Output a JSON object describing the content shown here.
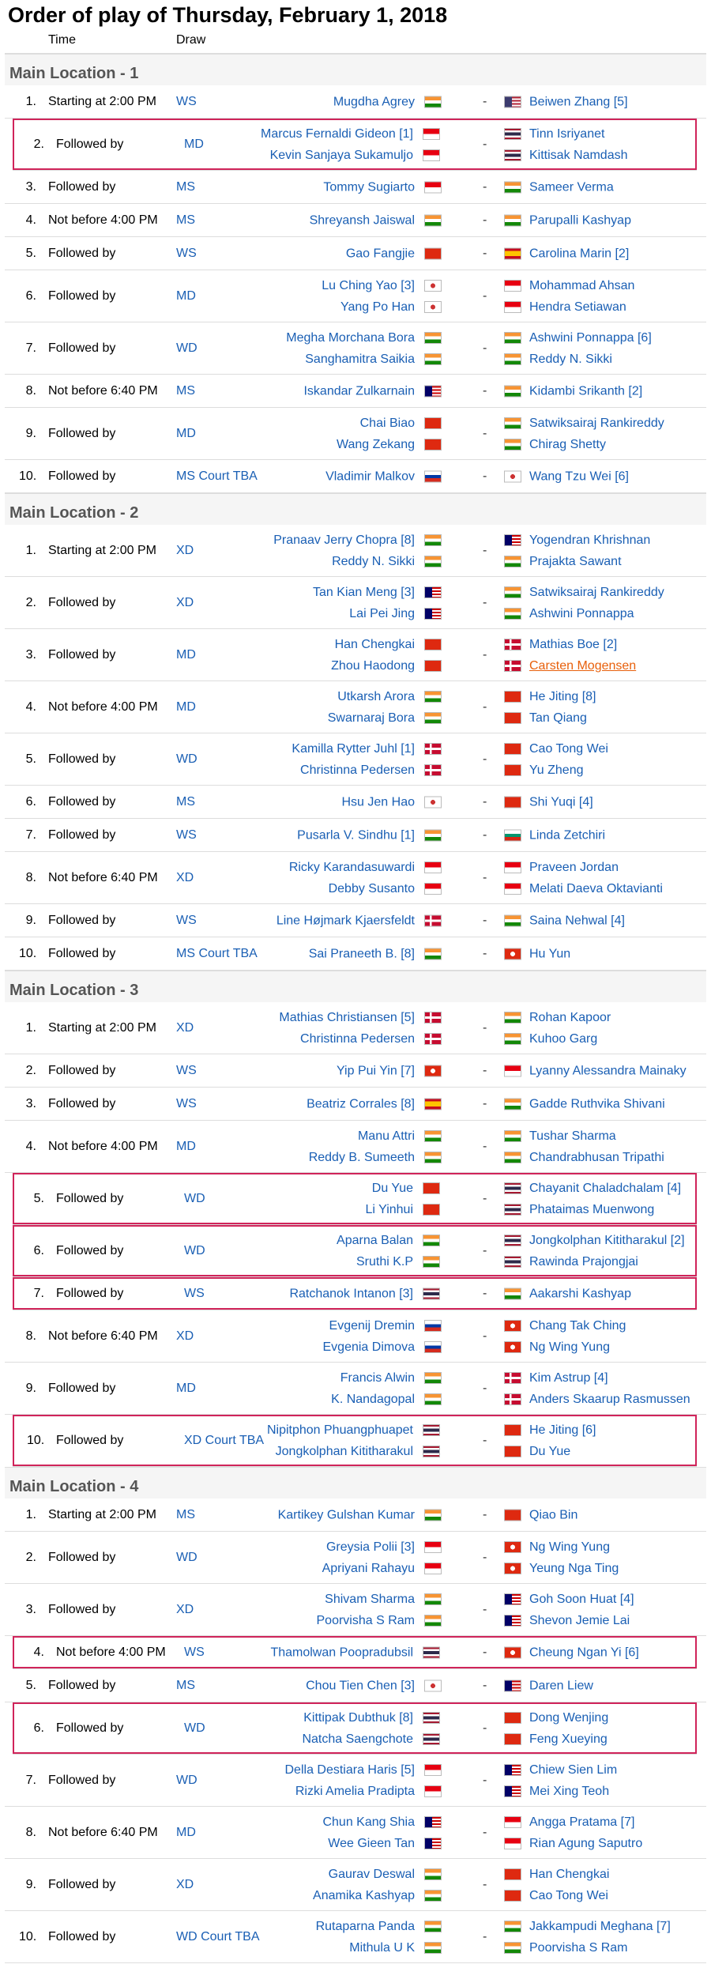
{
  "title": "Order of play of Thursday, February 1, 2018",
  "col_time": "Time",
  "col_draw": "Draw",
  "dash": "-",
  "flags": {
    "IND": "linear-gradient(#f79433 0 33%,#fff 33% 66%,#138808 66%)",
    "USA": "linear-gradient(90deg,#3c3b6e 0 45%,transparent 45%),repeating-linear-gradient(#b22234 0 2px,#fff 2px 4px)",
    "INA": "linear-gradient(#e70011 0 50%,#fff 50%)",
    "THA": "linear-gradient(#a51931 0 17%,#fff 17% 33%,#2d2a4a 33% 67%,#fff 67% 83%,#a51931 83%)",
    "CHN": "#de2910",
    "ESP": "linear-gradient(#c60b1e 0 25%,#ffc400 25% 75%,#c60b1e 75%)",
    "TPE": "radial-gradient(circle,#c33 0 3px,#fff 3px)",
    "MAS": "linear-gradient(90deg,#010066 0 45%,transparent 45%),repeating-linear-gradient(#cc0001 0 2px,#fff 2px 4px)",
    "RUS": "linear-gradient(#fff 0 33%,#0039a6 33% 66%,#d52b1e 66%)",
    "DEN": "linear-gradient(90deg,transparent 0 30%,#fff 30% 42%,transparent 42%),linear-gradient(transparent 0 40%,#fff 40% 60%,transparent 60%),#c60c30",
    "HKG": "radial-gradient(circle,#fff 0 3px,#de2910 3px)",
    "BUL": "linear-gradient(#fff 0 33%,#00966e 33% 66%,#d62612 66%)"
  },
  "sections": [
    {
      "title": "Main Location - 1",
      "rows": [
        {
          "n": "1.",
          "t": "Starting at 2:00 PM",
          "d": "WS",
          "l": [
            [
              "Mugdha Agrey",
              "IND"
            ]
          ],
          "r": [
            [
              "Beiwen Zhang [5]",
              "USA"
            ]
          ]
        },
        {
          "n": "2.",
          "t": "Followed by",
          "d": "MD",
          "hl": true,
          "l": [
            [
              "Marcus Fernaldi Gideon [1]",
              "INA"
            ],
            [
              "Kevin Sanjaya Sukamuljo",
              "INA"
            ]
          ],
          "r": [
            [
              "Tinn Isriyanet",
              "THA"
            ],
            [
              "Kittisak Namdash",
              "THA"
            ]
          ]
        },
        {
          "n": "3.",
          "t": "Followed by",
          "d": "MS",
          "l": [
            [
              "Tommy Sugiarto",
              "INA"
            ]
          ],
          "r": [
            [
              "Sameer Verma",
              "IND"
            ]
          ]
        },
        {
          "n": "4.",
          "t": "Not before 4:00 PM",
          "d": "MS",
          "l": [
            [
              "Shreyansh Jaiswal",
              "IND"
            ]
          ],
          "r": [
            [
              "Parupalli Kashyap",
              "IND"
            ]
          ]
        },
        {
          "n": "5.",
          "t": "Followed by",
          "d": "WS",
          "l": [
            [
              "Gao Fangjie",
              "CHN"
            ]
          ],
          "r": [
            [
              "Carolina Marin [2]",
              "ESP"
            ]
          ]
        },
        {
          "n": "6.",
          "t": "Followed by",
          "d": "MD",
          "l": [
            [
              "Lu Ching Yao [3]",
              "TPE"
            ],
            [
              "Yang Po Han",
              "TPE"
            ]
          ],
          "r": [
            [
              "Mohammad Ahsan",
              "INA"
            ],
            [
              "Hendra Setiawan",
              "INA"
            ]
          ]
        },
        {
          "n": "7.",
          "t": "Followed by",
          "d": "WD",
          "l": [
            [
              "Megha Morchana Bora",
              "IND"
            ],
            [
              "Sanghamitra Saikia",
              "IND"
            ]
          ],
          "r": [
            [
              "Ashwini Ponnappa [6]",
              "IND"
            ],
            [
              "Reddy N. Sikki",
              "IND"
            ]
          ]
        },
        {
          "n": "8.",
          "t": "Not before 6:40 PM",
          "d": "MS",
          "l": [
            [
              "Iskandar Zulkarnain",
              "MAS"
            ]
          ],
          "r": [
            [
              "Kidambi Srikanth [2]",
              "IND"
            ]
          ]
        },
        {
          "n": "9.",
          "t": "Followed by",
          "d": "MD",
          "l": [
            [
              "Chai Biao",
              "CHN"
            ],
            [
              "Wang Zekang",
              "CHN"
            ]
          ],
          "r": [
            [
              "Satwiksairaj Rankireddy",
              "IND"
            ],
            [
              "Chirag Shetty",
              "IND"
            ]
          ]
        },
        {
          "n": "10.",
          "t": "Followed by",
          "d": "MS Court TBA",
          "l": [
            [
              "Vladimir Malkov",
              "RUS"
            ]
          ],
          "r": [
            [
              "Wang Tzu Wei [6]",
              "TPE"
            ]
          ]
        }
      ]
    },
    {
      "title": "Main Location - 2",
      "rows": [
        {
          "n": "1.",
          "t": "Starting at 2:00 PM",
          "d": "XD",
          "l": [
            [
              "Pranaav Jerry Chopra [8]",
              "IND"
            ],
            [
              "Reddy N. Sikki",
              "IND"
            ]
          ],
          "r": [
            [
              "Yogendran Khrishnan",
              "MAS"
            ],
            [
              "Prajakta Sawant",
              "IND"
            ]
          ]
        },
        {
          "n": "2.",
          "t": "Followed by",
          "d": "XD",
          "l": [
            [
              "Tan Kian Meng [3]",
              "MAS"
            ],
            [
              "Lai Pei Jing",
              "MAS"
            ]
          ],
          "r": [
            [
              "Satwiksairaj Rankireddy",
              "IND"
            ],
            [
              "Ashwini Ponnappa",
              "IND"
            ]
          ]
        },
        {
          "n": "3.",
          "t": "Followed by",
          "d": "MD",
          "l": [
            [
              "Han Chengkai",
              "CHN"
            ],
            [
              "Zhou Haodong",
              "CHN"
            ]
          ],
          "r": [
            [
              "Mathias Boe [2]",
              "DEN"
            ],
            [
              "Carsten Mogensen",
              "DEN",
              "o"
            ]
          ]
        },
        {
          "n": "4.",
          "t": "Not before 4:00 PM",
          "d": "MD",
          "l": [
            [
              "Utkarsh Arora",
              "IND"
            ],
            [
              "Swarnaraj Bora",
              "IND"
            ]
          ],
          "r": [
            [
              "He Jiting [8]",
              "CHN"
            ],
            [
              "Tan Qiang",
              "CHN"
            ]
          ]
        },
        {
          "n": "5.",
          "t": "Followed by",
          "d": "WD",
          "l": [
            [
              "Kamilla Rytter Juhl [1]",
              "DEN"
            ],
            [
              "Christinna Pedersen",
              "DEN"
            ]
          ],
          "r": [
            [
              "Cao Tong Wei",
              "CHN"
            ],
            [
              "Yu Zheng",
              "CHN"
            ]
          ]
        },
        {
          "n": "6.",
          "t": "Followed by",
          "d": "MS",
          "l": [
            [
              "Hsu Jen Hao",
              "TPE"
            ]
          ],
          "r": [
            [
              "Shi Yuqi [4]",
              "CHN"
            ]
          ]
        },
        {
          "n": "7.",
          "t": "Followed by",
          "d": "WS",
          "l": [
            [
              "Pusarla V. Sindhu [1]",
              "IND"
            ]
          ],
          "r": [
            [
              "Linda Zetchiri",
              "BUL"
            ]
          ]
        },
        {
          "n": "8.",
          "t": "Not before 6:40 PM",
          "d": "XD",
          "l": [
            [
              "Ricky Karandasuwardi",
              "INA"
            ],
            [
              "Debby Susanto",
              "INA"
            ]
          ],
          "r": [
            [
              "Praveen Jordan",
              "INA"
            ],
            [
              "Melati Daeva Oktavianti",
              "INA"
            ]
          ]
        },
        {
          "n": "9.",
          "t": "Followed by",
          "d": "WS",
          "l": [
            [
              "Line Højmark Kjaersfeldt",
              "DEN"
            ]
          ],
          "r": [
            [
              "Saina Nehwal [4]",
              "IND"
            ]
          ]
        },
        {
          "n": "10.",
          "t": "Followed by",
          "d": "MS Court TBA",
          "l": [
            [
              "Sai Praneeth B. [8]",
              "IND"
            ]
          ],
          "r": [
            [
              "Hu Yun",
              "HKG"
            ]
          ]
        }
      ]
    },
    {
      "title": "Main Location - 3",
      "rows": [
        {
          "n": "1.",
          "t": "Starting at 2:00 PM",
          "d": "XD",
          "l": [
            [
              "Mathias Christiansen [5]",
              "DEN"
            ],
            [
              "Christinna Pedersen",
              "DEN"
            ]
          ],
          "r": [
            [
              "Rohan Kapoor",
              "IND"
            ],
            [
              "Kuhoo Garg",
              "IND"
            ]
          ]
        },
        {
          "n": "2.",
          "t": "Followed by",
          "d": "WS",
          "l": [
            [
              "Yip Pui Yin [7]",
              "HKG"
            ]
          ],
          "r": [
            [
              "Lyanny Alessandra Mainaky",
              "INA"
            ]
          ]
        },
        {
          "n": "3.",
          "t": "Followed by",
          "d": "WS",
          "l": [
            [
              "Beatriz Corrales [8]",
              "ESP"
            ]
          ],
          "r": [
            [
              "Gadde Ruthvika Shivani",
              "IND"
            ]
          ]
        },
        {
          "n": "4.",
          "t": "Not before 4:00 PM",
          "d": "MD",
          "l": [
            [
              "Manu Attri",
              "IND"
            ],
            [
              "Reddy B. Sumeeth",
              "IND"
            ]
          ],
          "r": [
            [
              "Tushar Sharma",
              "IND"
            ],
            [
              "Chandrabhusan Tripathi",
              "IND"
            ]
          ]
        },
        {
          "n": "5.",
          "t": "Followed by",
          "d": "WD",
          "hl": true,
          "l": [
            [
              "Du Yue",
              "CHN"
            ],
            [
              "Li Yinhui",
              "CHN"
            ]
          ],
          "r": [
            [
              "Chayanit Chaladchalam [4]",
              "THA"
            ],
            [
              "Phataimas Muenwong",
              "THA"
            ]
          ]
        },
        {
          "n": "6.",
          "t": "Followed by",
          "d": "WD",
          "hl": true,
          "l": [
            [
              "Aparna Balan",
              "IND"
            ],
            [
              "Sruthi K.P",
              "IND"
            ]
          ],
          "r": [
            [
              "Jongkolphan Kititharakul [2]",
              "THA"
            ],
            [
              "Rawinda Prajongjai",
              "THA"
            ]
          ]
        },
        {
          "n": "7.",
          "t": "Followed by",
          "d": "WS",
          "hl": true,
          "l": [
            [
              "Ratchanok Intanon [3]",
              "THA"
            ]
          ],
          "r": [
            [
              "Aakarshi Kashyap",
              "IND"
            ]
          ]
        },
        {
          "n": "8.",
          "t": "Not before 6:40 PM",
          "d": "XD",
          "l": [
            [
              "Evgenij Dremin",
              "RUS"
            ],
            [
              "Evgenia Dimova",
              "RUS"
            ]
          ],
          "r": [
            [
              "Chang Tak Ching",
              "HKG"
            ],
            [
              "Ng Wing Yung",
              "HKG"
            ]
          ]
        },
        {
          "n": "9.",
          "t": "Followed by",
          "d": "MD",
          "l": [
            [
              "Francis Alwin",
              "IND"
            ],
            [
              "K. Nandagopal",
              "IND"
            ]
          ],
          "r": [
            [
              "Kim Astrup [4]",
              "DEN"
            ],
            [
              "Anders Skaarup Rasmussen",
              "DEN"
            ]
          ]
        },
        {
          "n": "10.",
          "t": "Followed by",
          "d": "XD Court TBA",
          "hl": true,
          "l": [
            [
              "Nipitphon Phuangphuapet",
              "THA"
            ],
            [
              "Jongkolphan Kititharakul",
              "THA"
            ]
          ],
          "r": [
            [
              "He Jiting [6]",
              "CHN"
            ],
            [
              "Du Yue",
              "CHN"
            ]
          ]
        }
      ]
    },
    {
      "title": "Main Location - 4",
      "rows": [
        {
          "n": "1.",
          "t": "Starting at 2:00 PM",
          "d": "MS",
          "l": [
            [
              "Kartikey Gulshan Kumar",
              "IND"
            ]
          ],
          "r": [
            [
              "Qiao Bin",
              "CHN"
            ]
          ]
        },
        {
          "n": "2.",
          "t": "Followed by",
          "d": "WD",
          "l": [
            [
              "Greysia Polii [3]",
              "INA"
            ],
            [
              "Apriyani Rahayu",
              "INA"
            ]
          ],
          "r": [
            [
              "Ng Wing Yung",
              "HKG"
            ],
            [
              "Yeung Nga Ting",
              "HKG"
            ]
          ]
        },
        {
          "n": "3.",
          "t": "Followed by",
          "d": "XD",
          "l": [
            [
              "Shivam Sharma",
              "IND"
            ],
            [
              "Poorvisha S Ram",
              "IND"
            ]
          ],
          "r": [
            [
              "Goh Soon Huat [4]",
              "MAS"
            ],
            [
              "Shevon Jemie Lai",
              "MAS"
            ]
          ]
        },
        {
          "n": "4.",
          "t": "Not before 4:00 PM",
          "d": "WS",
          "hl": true,
          "l": [
            [
              "Thamolwan Poopradubsil",
              "THA"
            ]
          ],
          "r": [
            [
              "Cheung Ngan Yi [6]",
              "HKG"
            ]
          ]
        },
        {
          "n": "5.",
          "t": "Followed by",
          "d": "MS",
          "l": [
            [
              "Chou Tien Chen [3]",
              "TPE"
            ]
          ],
          "r": [
            [
              "Daren Liew",
              "MAS"
            ]
          ]
        },
        {
          "n": "6.",
          "t": "Followed by",
          "d": "WD",
          "hl": true,
          "l": [
            [
              "Kittipak Dubthuk [8]",
              "THA"
            ],
            [
              "Natcha Saengchote",
              "THA"
            ]
          ],
          "r": [
            [
              "Dong Wenjing",
              "CHN"
            ],
            [
              "Feng Xueying",
              "CHN"
            ]
          ]
        },
        {
          "n": "7.",
          "t": "Followed by",
          "d": "WD",
          "l": [
            [
              "Della Destiara Haris [5]",
              "INA"
            ],
            [
              "Rizki Amelia Pradipta",
              "INA"
            ]
          ],
          "r": [
            [
              "Chiew Sien Lim",
              "MAS"
            ],
            [
              "Mei Xing Teoh",
              "MAS"
            ]
          ]
        },
        {
          "n": "8.",
          "t": "Not before 6:40 PM",
          "d": "MD",
          "l": [
            [
              "Chun Kang Shia",
              "MAS"
            ],
            [
              "Wee Gieen Tan",
              "MAS"
            ]
          ],
          "r": [
            [
              "Angga Pratama [7]",
              "INA"
            ],
            [
              "Rian Agung Saputro",
              "INA"
            ]
          ]
        },
        {
          "n": "9.",
          "t": "Followed by",
          "d": "XD",
          "l": [
            [
              "Gaurav Deswal",
              "IND"
            ],
            [
              "Anamika Kashyap",
              "IND"
            ]
          ],
          "r": [
            [
              "Han Chengkai",
              "CHN"
            ],
            [
              "Cao Tong Wei",
              "CHN"
            ]
          ]
        },
        {
          "n": "10.",
          "t": "Followed by",
          "d": "WD Court TBA",
          "l": [
            [
              "Rutaparna Panda",
              "IND"
            ],
            [
              "Mithula U K",
              "IND"
            ]
          ],
          "r": [
            [
              "Jakkampudi Meghana [7]",
              "IND"
            ],
            [
              "Poorvisha S Ram",
              "IND"
            ]
          ]
        }
      ]
    }
  ]
}
